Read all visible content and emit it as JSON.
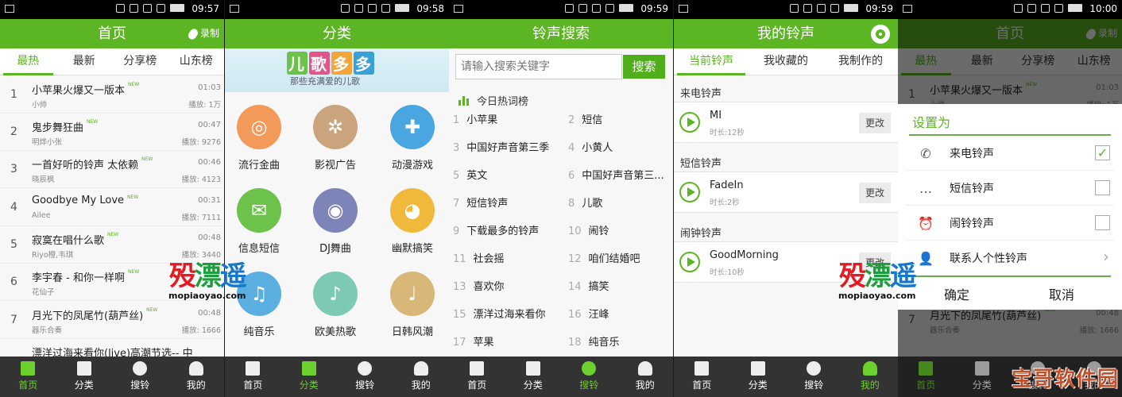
{
  "colors": {
    "brand": "#5cb522",
    "nav_bg": "#333333",
    "active_nav": "#6cd12c"
  },
  "nav": [
    "首页",
    "分类",
    "搜铃",
    "我的"
  ],
  "nav_icons": [
    "home-icon",
    "grid-icon",
    "search-icon",
    "user-icon"
  ],
  "panels": [
    {
      "time": "09:57",
      "title": "首页",
      "record": "录制",
      "active_nav": 0,
      "tabs": [
        "最热",
        "最新",
        "分享榜",
        "山东榜"
      ],
      "songs": [
        {
          "num": "1",
          "title": "小苹果火爆又一版本",
          "badge": "NEW",
          "artist": "小帅",
          "duration": "01:03",
          "plays": "播放: 1万"
        },
        {
          "num": "2",
          "title": "鬼步舞狂曲",
          "badge": "NEW",
          "artist": "明烨小张",
          "duration": "00:47",
          "plays": "播放: 9276"
        },
        {
          "num": "3",
          "title": "一首好听的铃声 太依赖",
          "badge": "NEW",
          "artist": "晓辰枫",
          "duration": "00:46",
          "plays": "播放: 4123"
        },
        {
          "num": "4",
          "title": "Goodbye My Love",
          "badge": "NEW",
          "artist": "Ailee",
          "duration": "00:31",
          "plays": "播放: 7111"
        },
        {
          "num": "5",
          "title": "寂寞在唱什么歌",
          "badge": "NEW",
          "artist": "Riyo橙,韦琪",
          "duration": "00:48",
          "plays": "播放: 3440"
        },
        {
          "num": "6",
          "title": "李宇春 - 和你一样啊",
          "badge": "NEW",
          "artist": "花仙子",
          "duration": "",
          "plays": ""
        },
        {
          "num": "7",
          "title": "月光下的凤尾竹(葫芦丝)",
          "badge": "NEW",
          "artist": "器乐合奏",
          "duration": "00:48",
          "plays": "播放: 1666"
        },
        {
          "num": "",
          "title": "漂洋过海来看你(live)高潮节选-- 中",
          "badge": "",
          "artist": "",
          "duration": "",
          "plays": ""
        }
      ]
    },
    {
      "time": "09:58",
      "title": "分类",
      "active_nav": 1,
      "banner": {
        "title": "儿歌多多",
        "subtitle": "那些充满爱的儿歌"
      },
      "categories": [
        {
          "label": "流行金曲",
          "icon": "globe-icon",
          "color": "#f39a5a",
          "glyph": "◎"
        },
        {
          "label": "影视广告",
          "icon": "film-reel-icon",
          "color": "#c9a47c",
          "glyph": "✲"
        },
        {
          "label": "动漫游戏",
          "icon": "gamepad-icon",
          "color": "#4aa6e0",
          "glyph": "✚"
        },
        {
          "label": "信息短信",
          "icon": "mail-icon",
          "color": "#6cc24a",
          "glyph": "✉"
        },
        {
          "label": "DJ舞曲",
          "icon": "disc-icon",
          "color": "#7d85b8",
          "glyph": "◉"
        },
        {
          "label": "幽默搞笑",
          "icon": "pacman-icon",
          "color": "#f0b93c",
          "glyph": "◕"
        },
        {
          "label": "纯音乐",
          "icon": "music-note-icon",
          "color": "#5aaee0",
          "glyph": "♫"
        },
        {
          "label": "欧美热歌",
          "icon": "singer-icon",
          "color": "#7cc9b4",
          "glyph": "♪"
        },
        {
          "label": "日韩风潮",
          "icon": "guitar-icon",
          "color": "#d9b779",
          "glyph": "♩"
        }
      ]
    },
    {
      "time": "09:59",
      "title": "铃声搜索",
      "active_nav": 2,
      "search_placeholder": "请输入搜索关键字",
      "search_button": "搜索",
      "hot_title": "今日热词榜",
      "hot_words": [
        {
          "n": "1",
          "w": "小苹果"
        },
        {
          "n": "2",
          "w": "短信"
        },
        {
          "n": "3",
          "w": "中国好声音第三季"
        },
        {
          "n": "4",
          "w": "小黄人"
        },
        {
          "n": "5",
          "w": "英文"
        },
        {
          "n": "6",
          "w": "中国好声音第三..."
        },
        {
          "n": "7",
          "w": "短信铃声"
        },
        {
          "n": "8",
          "w": "儿歌"
        },
        {
          "n": "9",
          "w": "下载最多的铃声"
        },
        {
          "n": "10",
          "w": "闹铃"
        },
        {
          "n": "11",
          "w": "社会摇"
        },
        {
          "n": "12",
          "w": "咱们结婚吧"
        },
        {
          "n": "13",
          "w": "喜欢你"
        },
        {
          "n": "14",
          "w": "搞笑"
        },
        {
          "n": "15",
          "w": "漂洋过海来看你"
        },
        {
          "n": "16",
          "w": "汪峰"
        },
        {
          "n": "17",
          "w": "苹果"
        },
        {
          "n": "18",
          "w": "纯音乐"
        }
      ]
    },
    {
      "time": "09:59",
      "title": "我的铃声",
      "active_nav": 3,
      "tabs": [
        "当前铃声",
        "我收藏的",
        "我制作的"
      ],
      "sections": [
        {
          "heading": "来电铃声",
          "name": "MI",
          "length": "时长:12秒",
          "button": "更改"
        },
        {
          "heading": "短信铃声",
          "name": "FadeIn",
          "length": "时长:2秒",
          "button": "更改"
        },
        {
          "heading": "闹钟铃声",
          "name": "GoodMorning",
          "length": "时长:10秒",
          "button": "更改"
        }
      ]
    },
    {
      "time": "10:00",
      "title": "首页",
      "record": "录制",
      "active_nav": 0,
      "tabs": [
        "最热",
        "最新",
        "分享榜",
        "山东榜"
      ],
      "songs": [
        {
          "num": "1",
          "title": "小苹果火爆又一版本",
          "badge": "NEW",
          "artist": "小帅",
          "duration": "01:03",
          "plays": "播放: 1万"
        },
        {
          "num": "7",
          "title": "月光下的凤尾竹(葫芦丝)",
          "badge": "NEW",
          "artist": "器乐合奏",
          "duration": "00:48",
          "plays": "播放: 1666"
        }
      ],
      "dialog": {
        "title": "设置为",
        "options": [
          {
            "label": "来电铃声",
            "icon": "phone-icon",
            "glyph": "✆",
            "checked": true
          },
          {
            "label": "短信铃声",
            "icon": "chat-bubble-icon",
            "glyph": "…",
            "checked": false
          },
          {
            "label": "闹铃铃声",
            "icon": "alarm-clock-icon",
            "glyph": "⏰",
            "checked": false
          },
          {
            "label": "联系人个性铃声",
            "icon": "contact-icon",
            "glyph": "👤",
            "arrow": true
          }
        ],
        "confirm": "确定",
        "cancel": "取消"
      }
    }
  ],
  "watermark": {
    "logo": "殁漂遥",
    "url": "mopiaoyao.com",
    "corner": "宝哥软件园"
  }
}
